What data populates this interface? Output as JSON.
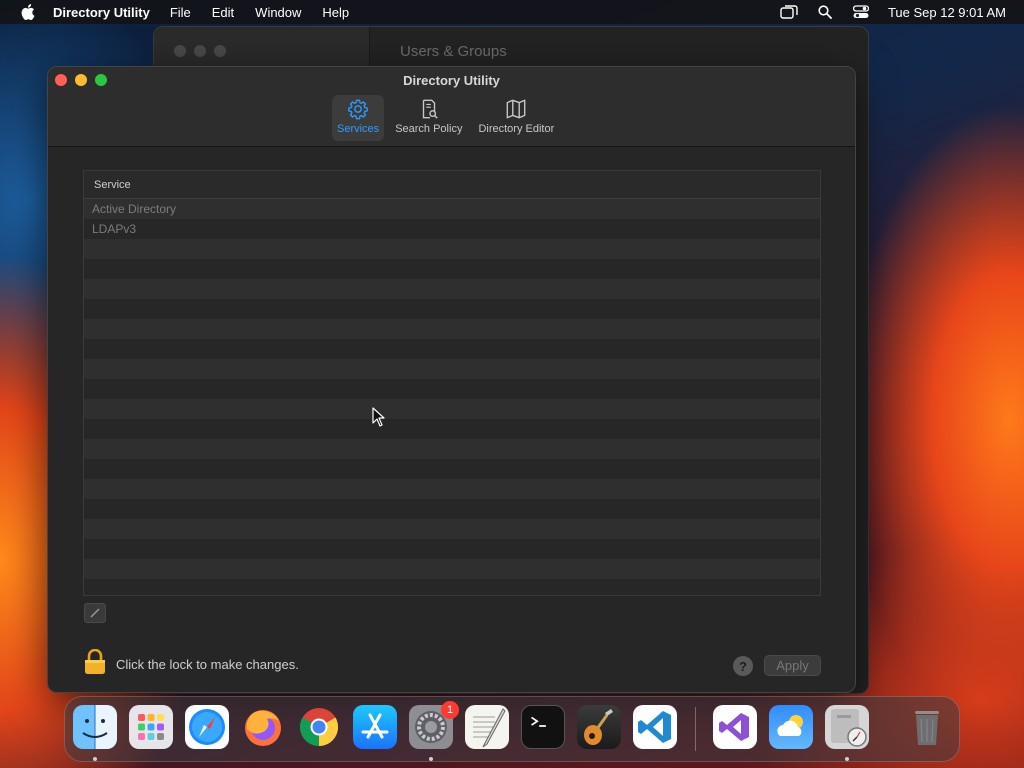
{
  "menubar": {
    "app_name": "Directory Utility",
    "items": [
      "File",
      "Edit",
      "Window",
      "Help"
    ],
    "datetime": "Tue Sep 12  9:01 AM"
  },
  "background_window": {
    "title": "Users & Groups"
  },
  "window": {
    "title": "Directory Utility",
    "toolbar": [
      {
        "label": "Services",
        "icon": "gear-icon",
        "active": true
      },
      {
        "label": "Search Policy",
        "icon": "search-policy-icon",
        "active": false
      },
      {
        "label": "Directory Editor",
        "icon": "map-icon",
        "active": false
      }
    ],
    "table": {
      "header": "Service",
      "rows": [
        "Active Directory",
        "LDAPv3"
      ]
    },
    "lock_text": "Click the lock to make changes.",
    "help_label": "?",
    "apply_label": "Apply"
  },
  "dock": {
    "apps": [
      {
        "name": "Finder",
        "icon": "finder-icon"
      },
      {
        "name": "Launchpad",
        "icon": "launchpad-icon"
      },
      {
        "name": "Safari",
        "icon": "safari-icon"
      },
      {
        "name": "Firefox",
        "icon": "firefox-icon"
      },
      {
        "name": "Chrome",
        "icon": "chrome-icon"
      },
      {
        "name": "App Store",
        "icon": "app-store-icon"
      },
      {
        "name": "System Settings",
        "icon": "system-settings-icon",
        "badge": "1"
      },
      {
        "name": "TextEdit",
        "icon": "textedit-icon"
      },
      {
        "name": "Terminal",
        "icon": "terminal-icon"
      },
      {
        "name": "GarageBand",
        "icon": "garageband-icon"
      },
      {
        "name": "Visual Studio Code",
        "icon": "vscode-icon"
      },
      {
        "name": "Visual Studio",
        "icon": "visual-studio-icon"
      },
      {
        "name": "Weather",
        "icon": "weather-icon"
      },
      {
        "name": "Directory Utility",
        "icon": "directory-utility-icon"
      },
      {
        "name": "Trash",
        "icon": "trash-icon"
      }
    ]
  },
  "colors": {
    "accent": "#2f9bff",
    "close": "#ff5f57",
    "minimize": "#febc2e",
    "maximize": "#28c840"
  }
}
